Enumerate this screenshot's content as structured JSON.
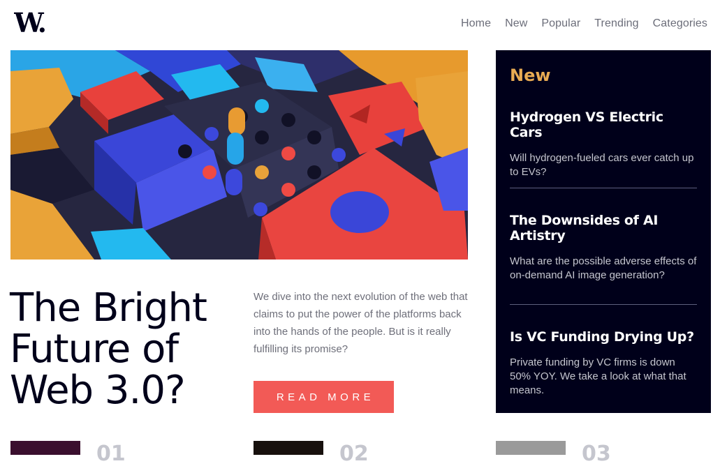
{
  "brand": {
    "logo_text": "W."
  },
  "nav": {
    "items": [
      "Home",
      "New",
      "Popular",
      "Trending",
      "Categories"
    ]
  },
  "hero": {
    "image": "abstract-3d-blocks-illustration",
    "title": "The Bright Future of Web 3.0?",
    "description": "We dive into the next evolution of the web that claims to put the power of the platforms back into the hands of the people. But is it really fulfilling its promise?",
    "button_label": "READ MORE"
  },
  "sidebar": {
    "title": "New",
    "items": [
      {
        "title": "Hydrogen VS Electric Cars",
        "text": "Will hydrogen-fueled cars ever catch up to EVs?"
      },
      {
        "title": "The Downsides of AI Artistry",
        "text": "What are the possible adverse effects of on-demand AI image generation?"
      },
      {
        "title": "Is VC Funding Drying Up?",
        "text": "Private funding by VC firms is down 50% YOY. We take a look at what that means."
      }
    ]
  },
  "bottom": {
    "items": [
      {
        "number": "01",
        "thumb_color": "#3a0f2e"
      },
      {
        "number": "02",
        "thumb_color": "#17100d"
      },
      {
        "number": "03",
        "thumb_color": "#9a9a9a"
      }
    ]
  },
  "colors": {
    "accent_red": "#f25a56",
    "accent_orange": "#e9ab53",
    "dark_navy": "#00001a",
    "text_grey": "#6e6f7a"
  }
}
